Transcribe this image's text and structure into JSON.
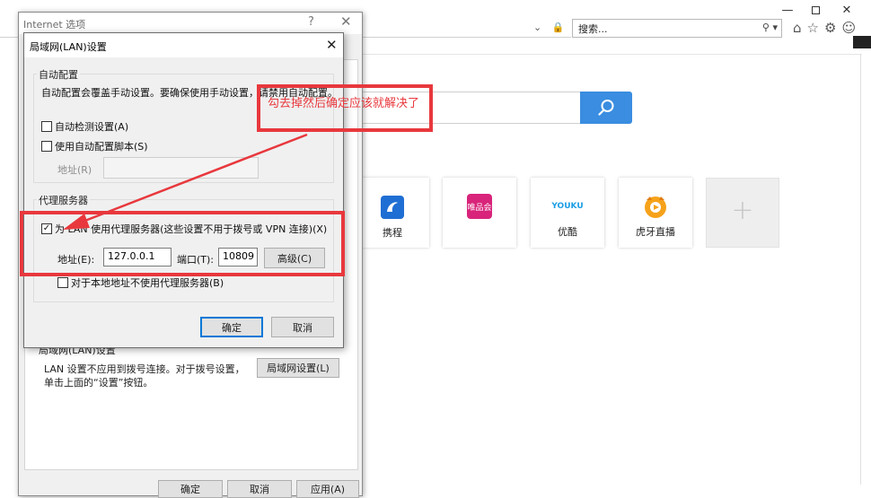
{
  "browser": {
    "search_placeholder": "搜索...",
    "window_controls": {
      "minimize": "—",
      "close": "✕"
    },
    "toolbar_icons": [
      "home-icon",
      "star-icon",
      "gear-icon",
      "smiley-icon"
    ],
    "addr_icons": "⌄ 🔒 ↻",
    "tiles": [
      {
        "label": "携程",
        "logo_color": "#1f6ed4"
      },
      {
        "label": "",
        "logo_text": "唯品会",
        "logo_color": "#d8247a"
      },
      {
        "label": "优酷",
        "logo_text": "YOUKU",
        "logo_color": "#ffffff"
      },
      {
        "label": "虎牙直播",
        "logo_color": "#f6a21a"
      },
      {
        "label": "+"
      }
    ],
    "accent": "#3a8de0"
  },
  "internet_options": {
    "title": "Internet 选项",
    "help": "?",
    "close": "✕",
    "lan_group": "局域网(LAN)设置",
    "lan_desc": "LAN 设置不应用到拨号连接。对于拨号设置，单击上面的“设置”按钮。",
    "lan_button": "局域网设置(L)",
    "ok": "确定",
    "cancel": "取消",
    "apply": "应用(A)"
  },
  "lan_dialog": {
    "title": "局域网(LAN)设置",
    "close": "✕",
    "auto_group": "自动配置",
    "auto_desc": "自动配置会覆盖手动设置。要确保使用手动设置，请禁用自动配置。",
    "auto_detect": "自动检测设置(A)",
    "use_script": "使用自动配置脚本(S)",
    "script_address_label": "地址(R)",
    "proxy_group": "代理服务器",
    "use_proxy": "为 LAN 使用代理服务器(这些设置不用于拨号或 VPN 连接)(X)",
    "use_proxy_checked": true,
    "address_label": "地址(E):",
    "address_value": "127.0.0.1",
    "port_label": "端口(T):",
    "port_value": "10809",
    "advanced": "高级(C)",
    "bypass_local": "对于本地地址不使用代理服务器(B)",
    "ok": "确定",
    "cancel": "取消"
  },
  "annotation": {
    "text": "勾去掉然后确定应该就解决了",
    "color": "#e8383d"
  }
}
